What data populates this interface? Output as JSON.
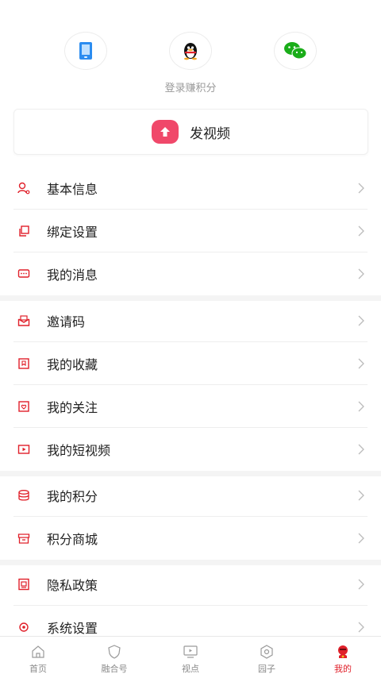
{
  "login": {
    "options": [
      {
        "name": "phone-login",
        "icon": "phone-icon",
        "color": "#2b8cf0"
      },
      {
        "name": "qq-login",
        "icon": "qq-penguin-icon",
        "color": "#111111"
      },
      {
        "name": "wechat-login",
        "icon": "wechat-icon",
        "color": "#1aad19"
      }
    ],
    "hint": "登录赚积分"
  },
  "post_video": {
    "label": "发视频",
    "icon": "upload-arrow-icon",
    "color": "#f0486a"
  },
  "menu_groups": [
    [
      {
        "label": "基本信息",
        "icon": "user-icon"
      },
      {
        "label": "绑定设置",
        "icon": "link-copy-icon"
      },
      {
        "label": "我的消息",
        "icon": "message-icon"
      }
    ],
    [
      {
        "label": "邀请码",
        "icon": "invite-icon"
      },
      {
        "label": "我的收藏",
        "icon": "bookmark-icon"
      },
      {
        "label": "我的关注",
        "icon": "follow-icon"
      },
      {
        "label": "我的短视频",
        "icon": "video-icon"
      }
    ],
    [
      {
        "label": "我的积分",
        "icon": "coins-icon"
      },
      {
        "label": "积分商城",
        "icon": "shop-icon"
      }
    ],
    [
      {
        "label": "隐私政策",
        "icon": "privacy-icon"
      },
      {
        "label": "系统设置",
        "icon": "settings-icon"
      }
    ]
  ],
  "accent_color": "#e0202a",
  "tabs": [
    {
      "label": "首页",
      "icon": "home-icon",
      "active": false
    },
    {
      "label": "融合号",
      "icon": "shield-icon",
      "active": false
    },
    {
      "label": "视点",
      "icon": "tv-icon",
      "active": false
    },
    {
      "label": "园子",
      "icon": "hexagon-icon",
      "active": false
    },
    {
      "label": "我的",
      "icon": "profile-icon",
      "active": true
    }
  ]
}
